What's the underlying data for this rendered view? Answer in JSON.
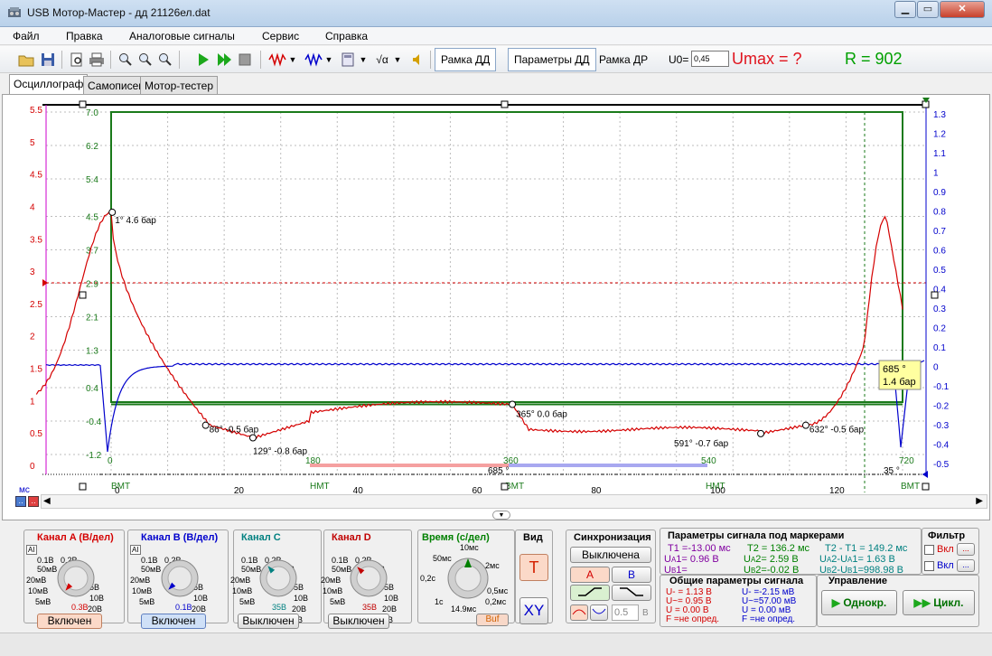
{
  "window": {
    "title": "USB Мотор-Мастер - дд 21126ел.dat"
  },
  "menu": [
    "Файл",
    "Правка",
    "Аналоговые сигналы",
    "Сервис",
    "Справка"
  ],
  "toolbar": {
    "frame_dd": "Рамка ДД",
    "params_dd": "Параметры ДД",
    "frame_dr": "Рамка ДР",
    "u0_label": "U0=",
    "u0_value": "0,45",
    "umax": "Umax = ?",
    "r": "R = 902"
  },
  "tabs": [
    "Осциллограф",
    "Самописец",
    "Мотор-тестер"
  ],
  "colors": {
    "red": "#d40000",
    "blue": "#0000cc",
    "green": "#007f00",
    "grid": "#c0c0c0",
    "frame": "#1a7a1a"
  },
  "chart_data": {
    "type": "line",
    "left_axis_ticks": [
      "5.5",
      "5",
      "4.5",
      "4",
      "3.5",
      "3",
      "2.5",
      "2",
      "1.5",
      "1",
      "0.5",
      "0"
    ],
    "green_axis_ticks": [
      "7.0",
      "6.2",
      "5.4",
      "4.5",
      "3.7",
      "2.9",
      "2.1",
      "1.3",
      "0.4",
      "-0.4",
      "-1.2"
    ],
    "right_axis_ticks": [
      "1.3",
      "1.2",
      "1.1",
      "1",
      "0.9",
      "0.8",
      "0.7",
      "0.6",
      "0.5",
      "0.4",
      "0.3",
      "0.2",
      "0.1",
      "0",
      "-0.1",
      "-0.2",
      "-0.3",
      "-0.4",
      "-0.5"
    ],
    "deg_ticks": [
      "0",
      "180",
      "360",
      "540",
      "720"
    ],
    "ms_ticks": [
      "0",
      "20",
      "40",
      "60",
      "80",
      "100",
      "120"
    ],
    "ms_unit": "мс",
    "tdc_labels": [
      "ВМТ",
      "НМТ",
      "ВМТ",
      "НМТ",
      "ВМТ"
    ],
    "below_labels": [
      "685 °",
      "35 °"
    ],
    "markers": [
      {
        "label": "1° 4.6 бар",
        "deg": 1,
        "bar": 4.6
      },
      {
        "label": "86° -0.5 бар",
        "deg": 86,
        "bar": -0.5
      },
      {
        "label": "129° -0.8 бар",
        "deg": 129,
        "bar": -0.8
      },
      {
        "label": "365° 0.0 бар",
        "deg": 365,
        "bar": 0.0
      },
      {
        "label": "591° -0.7 бар",
        "deg": 591,
        "bar": -0.7
      },
      {
        "label": "632° -0.5 бар",
        "deg": 632,
        "bar": -0.5
      }
    ],
    "tooltip": {
      "line1": "685 °",
      "line2": "1.4 бар"
    }
  },
  "channels": [
    {
      "title": "Канал A (В/дел)",
      "value": "0.3В",
      "button": "Включен",
      "color": "#d40000"
    },
    {
      "title": "Канал B (В/дел)",
      "value": "0.1В",
      "button": "Включен",
      "color": "#0000cc"
    },
    {
      "title": "Канал C",
      "value": "35В",
      "button": "Выключен",
      "color": "#008080"
    },
    {
      "title": "Канал D",
      "value": "35В",
      "button": "Выключен",
      "color": "#c00000"
    }
  ],
  "knob_labels": [
    "0.1В",
    "0.2В",
    "1В",
    "2В",
    "50мВ",
    "5В",
    "20мВ",
    "10В",
    "10мВ",
    "20В",
    "5мВ",
    "35В"
  ],
  "knob_small": [
    "AI",
    "AI"
  ],
  "time": {
    "title": "Время (с/дел)",
    "value": "14.9мс",
    "buf": "Buf",
    "labels": [
      "10мс",
      "50мс",
      "2мс",
      "0,2с",
      "0,5мс",
      "1с",
      "0,2мс"
    ]
  },
  "view": {
    "title": "Вид",
    "t": "T",
    "xy": "XY"
  },
  "sync": {
    "title": "Синхронизация",
    "off": "Выключена",
    "a": "A",
    "b": "B",
    "level": "0.5",
    "unit": "В"
  },
  "markers_params": {
    "title": "Параметры сигнала под маркерами",
    "t1": "T1 =-13.00 мс",
    "ua1": "U",
    "ua1_sub": "A",
    "ua1_val": "1= 0.96 В",
    "ub1": "U",
    "ub1_sub": "B",
    "ub1_val": "1=",
    "t2": "T2 = 136.2 мс",
    "ua2_val": "2= 2.59 В",
    "ub2_val": "2=-0.02 В",
    "dt": "T2 - T1 = 149.2 мс",
    "dua": "2-U",
    "dua_val": "1= 1.63 В",
    "dub_val": "1=998.98 В"
  },
  "general_params": {
    "title": "Общие параметры сигнала",
    "left": [
      "U- = 1.13 В",
      "U~= 0.95 В",
      "U = 0.00 В",
      "F =не опред."
    ],
    "right": [
      "U- =-2.15 мВ",
      "U~=57.00 мВ",
      "U = 0.00 мВ",
      "F =не опред."
    ]
  },
  "filter": {
    "title": "Фильтр",
    "vkl": "Вкл",
    "dots": "..."
  },
  "control": {
    "title": "Управление",
    "single": "Однокр.",
    "cycle": "Цикл."
  }
}
